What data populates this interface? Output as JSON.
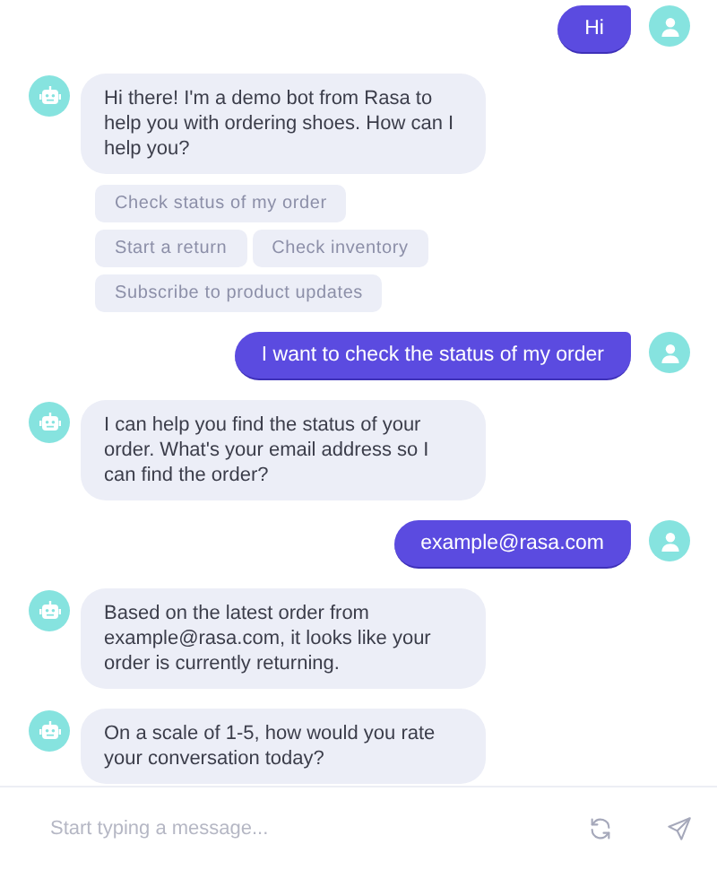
{
  "messages": [
    {
      "kind": "user",
      "text": "Hi"
    },
    {
      "kind": "bot",
      "text": "Hi there! I'm a demo bot from Rasa to help you with ordering shoes. How can I help you?",
      "quick_replies": [
        [
          "Check status of my order"
        ],
        [
          "Start a return",
          "Check inventory"
        ],
        [
          "Subscribe to product updates"
        ]
      ]
    },
    {
      "kind": "user",
      "text": "I want to check the status of my order"
    },
    {
      "kind": "bot",
      "text": "I can help you find the status of your order. What's your email address so I can find the order?"
    },
    {
      "kind": "user",
      "text": "example@rasa.com"
    },
    {
      "kind": "bot",
      "text": "Based on the latest order from example@rasa.com, it looks like your order is currently returning."
    },
    {
      "kind": "bot",
      "text": "On a scale of 1-5, how would you rate your conversation today?"
    }
  ],
  "composer": {
    "placeholder": "Start typing a message..."
  }
}
